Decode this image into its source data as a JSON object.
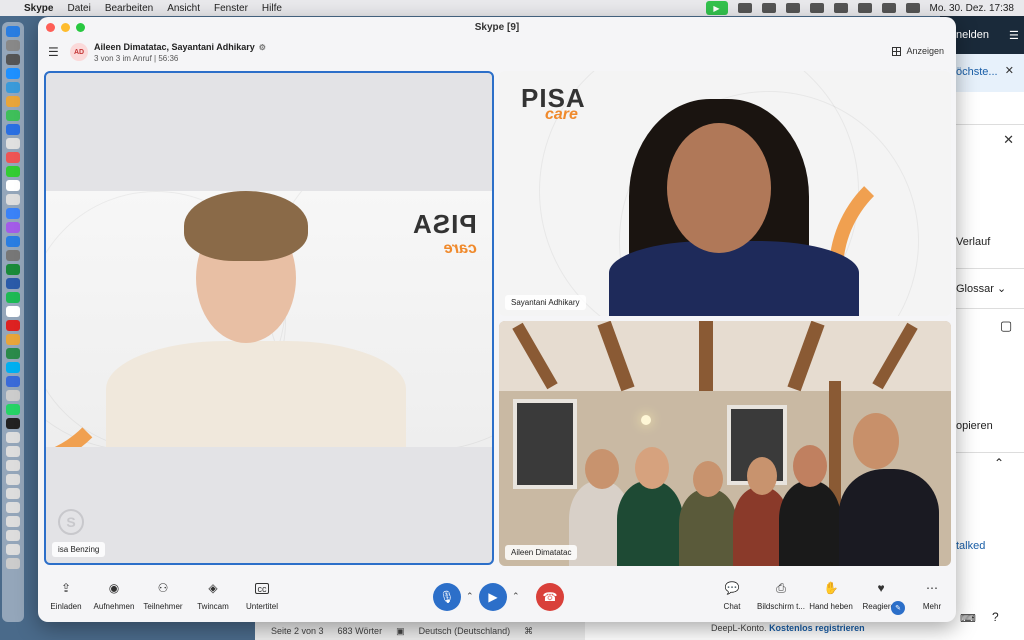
{
  "menubar": {
    "app": "Skype",
    "items": [
      "Datei",
      "Bearbeiten",
      "Ansicht",
      "Fenster",
      "Hilfe"
    ],
    "clock": "Mo. 30. Dez.  17:38"
  },
  "window": {
    "title": "Skype [9]"
  },
  "call": {
    "avatar_initials": "AD",
    "participants": "Aileen Dimatatac, Sayantani Adhikary",
    "status": "3 von 3 im Anruf | 56:36",
    "view_button": "Anzeigen"
  },
  "tiles": {
    "main_label": "isa Benzing",
    "top_right_label": "Sayantani Adhikary",
    "bottom_right_label": "Aileen Dimatatac"
  },
  "logo": {
    "pisa": "PISA",
    "care": "care"
  },
  "toolbar": {
    "invite": "Einladen",
    "record": "Aufnehmen",
    "participants": "Teilnehmer",
    "twincam": "Twincam",
    "subtitles": "Untertitel",
    "chat": "Chat",
    "screenshare": "Bildschirm t...",
    "raise_hand": "Hand heben",
    "react": "Reagieren",
    "more": "Mehr"
  },
  "background_app": {
    "header": "nelden",
    "highlight": "öchste...",
    "verlauf": "Verlauf",
    "glossar": "Glossar",
    "kopieren": "opieren",
    "talked": "talked"
  },
  "word_status": {
    "page": "Seite 2 von 3",
    "words": "683 Wörter",
    "language": "Deutsch (Deutschland)"
  },
  "deepl": {
    "text": "DeepL-Konto.",
    "link": "Kostenlos registrieren"
  },
  "colors": {
    "accent": "#2c6fc9",
    "hangup": "#d9403a",
    "logo_orange": "#f08a2c"
  }
}
